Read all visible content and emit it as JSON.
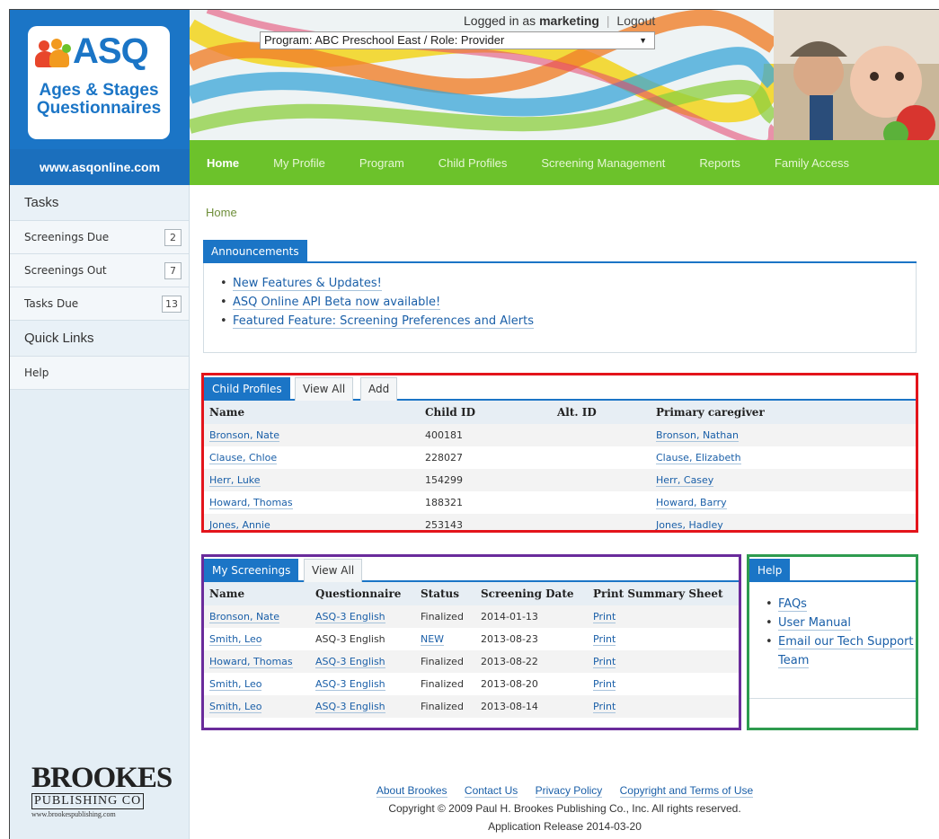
{
  "brand": {
    "logo_text": "ASQ",
    "logo_subtitle_1": "Ages & Stages",
    "logo_subtitle_2": "Questionnaires",
    "site_url": "www.asqonline.com",
    "primary_color": "#1b75c6",
    "nav_color": "#6cc22b"
  },
  "header": {
    "logged_in_prefix": "Logged in as",
    "username": "marketing",
    "logout_label": "Logout",
    "program_select_value": "Program: ABC Preschool East / Role: Provider"
  },
  "nav": {
    "items": [
      {
        "label": "Home",
        "active": true
      },
      {
        "label": "My Profile"
      },
      {
        "label": "Program"
      },
      {
        "label": "Child Profiles"
      },
      {
        "label": "Screening Management"
      },
      {
        "label": "Reports"
      },
      {
        "label": "Family Access"
      }
    ]
  },
  "sidebar": {
    "tasks_heading": "Tasks",
    "tasks": [
      {
        "label": "Screenings Due",
        "count": "2"
      },
      {
        "label": "Screenings Out",
        "count": "7"
      },
      {
        "label": "Tasks Due",
        "count": "13"
      }
    ],
    "quick_links_heading": "Quick Links",
    "quick_links": [
      {
        "label": "Help"
      }
    ],
    "publisher_logo": {
      "line1": "BROOKES",
      "line2": "PUBLISHING CO",
      "line3": "www.brookespublishing.com"
    }
  },
  "breadcrumb": "Home",
  "announcements": {
    "tab_label": "Announcements",
    "items": [
      "New Features & Updates!",
      "ASQ Online API Beta now available!",
      "Featured Feature: Screening Preferences and Alerts"
    ]
  },
  "child_profiles": {
    "tabs": [
      "Child Profiles",
      "View All",
      "Add"
    ],
    "columns": [
      "Name",
      "Child ID",
      "Alt. ID",
      "Primary caregiver"
    ],
    "rows": [
      {
        "name": "Bronson, Nate",
        "child_id": "400181",
        "alt_id": "",
        "caregiver": "Bronson, Nathan"
      },
      {
        "name": "Clause, Chloe",
        "child_id": "228027",
        "alt_id": "",
        "caregiver": "Clause, Elizabeth"
      },
      {
        "name": "Herr, Luke",
        "child_id": "154299",
        "alt_id": "",
        "caregiver": "Herr, Casey"
      },
      {
        "name": "Howard, Thomas",
        "child_id": "188321",
        "alt_id": "",
        "caregiver": "Howard, Barry"
      },
      {
        "name": "Jones, Annie",
        "child_id": "253143",
        "alt_id": "",
        "caregiver": "Jones, Hadley"
      }
    ]
  },
  "my_screenings": {
    "tabs": [
      "My Screenings",
      "View All"
    ],
    "columns": [
      "Name",
      "Questionnaire",
      "Status",
      "Screening Date",
      "Print Summary Sheet"
    ],
    "rows": [
      {
        "name": "Bronson, Nate",
        "questionnaire": "ASQ-3 English",
        "questionnaire_link": true,
        "status": "Finalized",
        "status_link": false,
        "date": "2014-01-13",
        "print": "Print"
      },
      {
        "name": "Smith, Leo",
        "questionnaire": "ASQ-3 English",
        "questionnaire_link": false,
        "status": "NEW",
        "status_link": true,
        "date": "2013-08-23",
        "print": "Print"
      },
      {
        "name": "Howard, Thomas",
        "questionnaire": "ASQ-3 English",
        "questionnaire_link": true,
        "status": "Finalized",
        "status_link": false,
        "date": "2013-08-22",
        "print": "Print"
      },
      {
        "name": "Smith, Leo",
        "questionnaire": "ASQ-3 English",
        "questionnaire_link": true,
        "status": "Finalized",
        "status_link": false,
        "date": "2013-08-20",
        "print": "Print"
      },
      {
        "name": "Smith, Leo",
        "questionnaire": "ASQ-3 English",
        "questionnaire_link": true,
        "status": "Finalized",
        "status_link": false,
        "date": "2013-08-14",
        "print": "Print"
      }
    ]
  },
  "help": {
    "tab_label": "Help",
    "items": [
      "FAQs",
      "User Manual",
      "Email our Tech Support Team"
    ]
  },
  "footer": {
    "links": [
      "About Brookes",
      "Contact Us",
      "Privacy Policy",
      "Copyright and Terms of Use"
    ],
    "copyright": "Copyright © 2009 Paul H. Brookes Publishing Co., Inc. All rights reserved.",
    "release": "Application Release 2014-03-20"
  }
}
